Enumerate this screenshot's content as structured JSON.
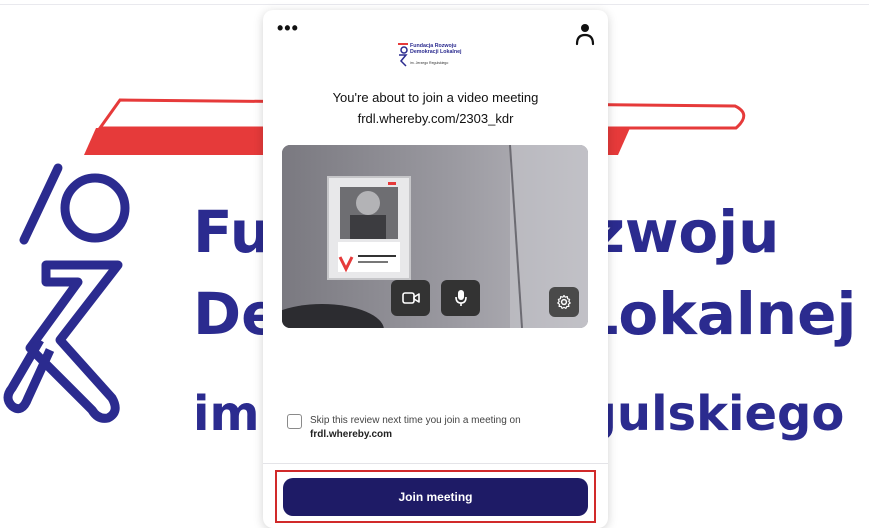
{
  "background": {
    "line1": "Fundacja Rozwoju",
    "line2": "Demokracji Lokalnej",
    "line3": "im. Jerzego Regulskiego"
  },
  "modal": {
    "menu_icon": "more-horizontal-icon",
    "user_icon": "user-icon",
    "mini_logo": {
      "line1": "Fundacja Rozwoju",
      "line2": "Demokracji Lokalnej",
      "line3": "im. Jerzego Regulskiego"
    },
    "title": "You're about to join a video meeting",
    "url": "frdl.whereby.com/2303_kdr",
    "controls": {
      "camera_icon": "camera-icon",
      "mic_icon": "microphone-icon",
      "settings_icon": "gear-icon"
    },
    "skip_review": {
      "checked": false,
      "text": "Skip this review next time you join a meeting on",
      "domain": "frdl.whereby.com"
    },
    "join_label": "Join meeting"
  },
  "colors": {
    "brand_blue": "#2b2b8f",
    "brand_red": "#e63a3a",
    "join_button": "#1e1b66",
    "highlight_outline": "#d12a2a"
  }
}
